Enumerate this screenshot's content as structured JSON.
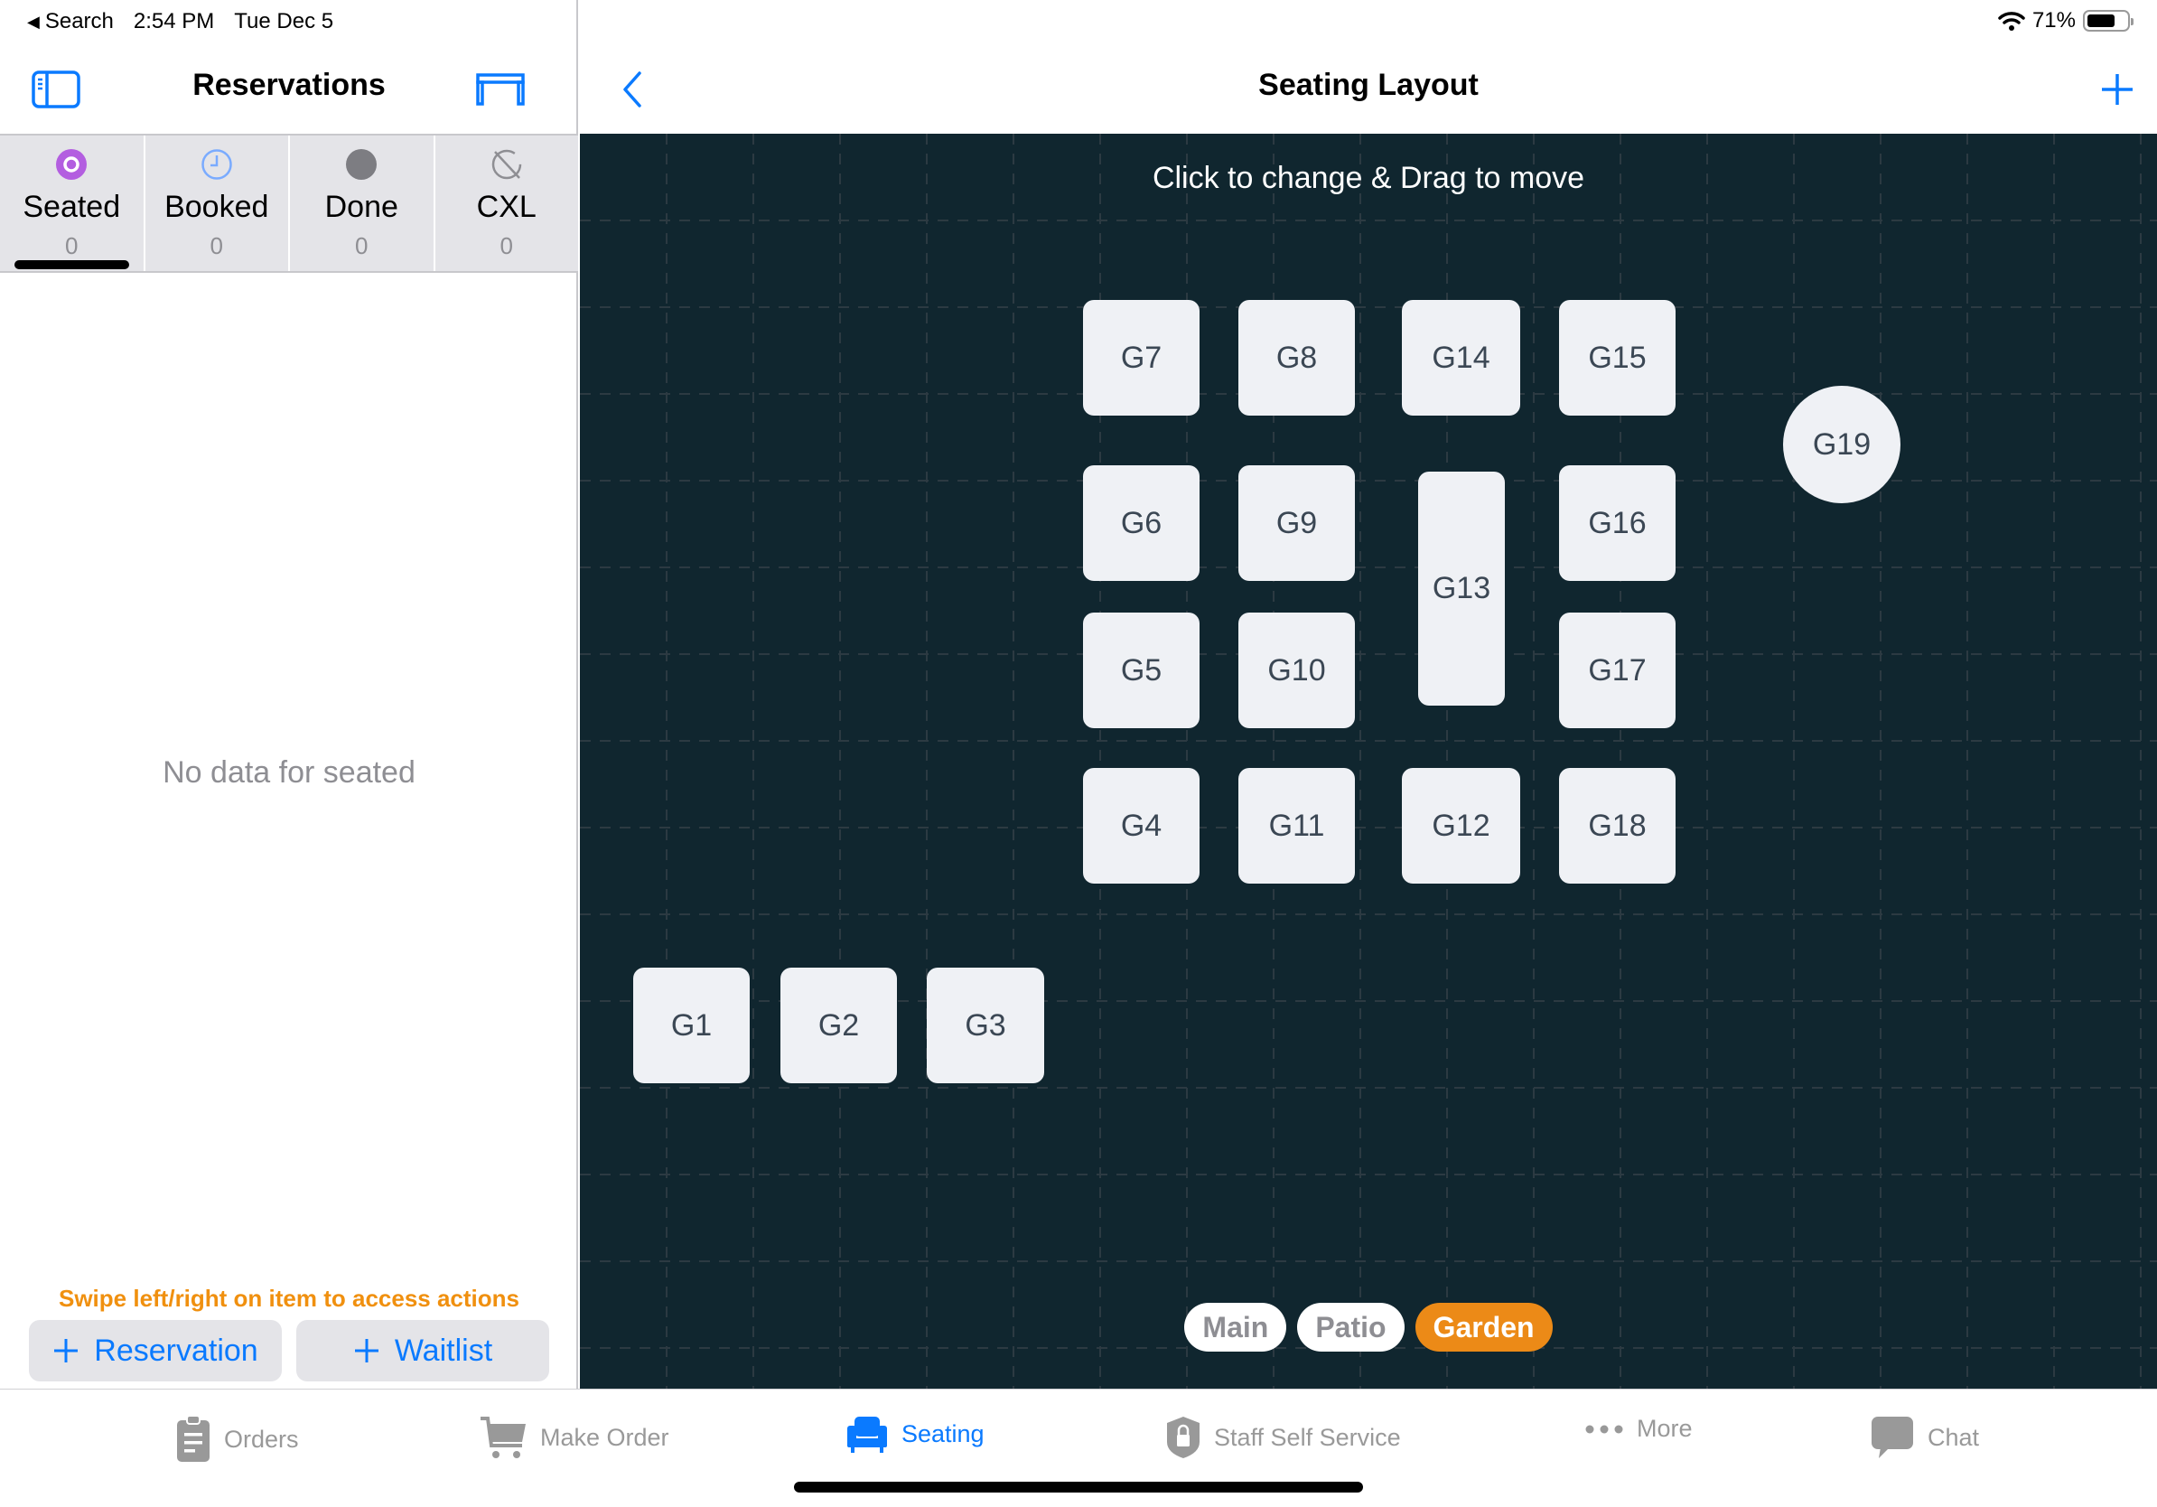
{
  "status_bar": {
    "back_app": "Search",
    "time": "2:54 PM",
    "date": "Tue Dec 5",
    "battery_percent": "71%",
    "battery_level": 0.71
  },
  "sidebar": {
    "title": "Reservations",
    "left_icon": "sidebar-toggle-icon",
    "right_icon": "table-icon",
    "tabs": [
      {
        "label": "Seated",
        "count": "0",
        "icon": "seated-icon",
        "color": "#b35ee0",
        "active": true
      },
      {
        "label": "Booked",
        "count": "0",
        "icon": "clock-icon",
        "color": "#7aabff",
        "active": false
      },
      {
        "label": "Done",
        "count": "0",
        "icon": "filled-circle-icon",
        "color": "#7d7d82",
        "active": false
      },
      {
        "label": "CXL",
        "count": "0",
        "icon": "cancelled-icon",
        "color": "#8e8e93",
        "active": false
      }
    ],
    "empty_message": "No data for seated",
    "hint": "Swipe left/right on item to access actions",
    "buttons": {
      "reservation": "Reservation",
      "waitlist": "Waitlist"
    }
  },
  "main": {
    "title": "Seating Layout",
    "back_icon": "chevron-left-icon",
    "add_icon": "plus-icon",
    "canvas_hint": "Click to change & Drag to move",
    "tables": [
      {
        "label": "G1",
        "shape": "rect"
      },
      {
        "label": "G2",
        "shape": "rect"
      },
      {
        "label": "G3",
        "shape": "rect"
      },
      {
        "label": "G4",
        "shape": "rect"
      },
      {
        "label": "G5",
        "shape": "rect"
      },
      {
        "label": "G6",
        "shape": "rect"
      },
      {
        "label": "G7",
        "shape": "rect"
      },
      {
        "label": "G8",
        "shape": "rect"
      },
      {
        "label": "G9",
        "shape": "rect"
      },
      {
        "label": "G10",
        "shape": "rect"
      },
      {
        "label": "G11",
        "shape": "rect"
      },
      {
        "label": "G12",
        "shape": "rect"
      },
      {
        "label": "G13",
        "shape": "rect"
      },
      {
        "label": "G14",
        "shape": "rect"
      },
      {
        "label": "G15",
        "shape": "rect"
      },
      {
        "label": "G16",
        "shape": "rect"
      },
      {
        "label": "G17",
        "shape": "rect"
      },
      {
        "label": "G18",
        "shape": "rect"
      },
      {
        "label": "G19",
        "shape": "round"
      }
    ],
    "areas": [
      {
        "label": "Main",
        "active": false
      },
      {
        "label": "Patio",
        "active": false
      },
      {
        "label": "Garden",
        "active": true
      }
    ],
    "accent_color": "#ec8a17"
  },
  "tab_bar": {
    "items": [
      {
        "label": "Orders",
        "icon": "clipboard-icon",
        "active": false
      },
      {
        "label": "Make Order",
        "icon": "cart-icon",
        "active": false
      },
      {
        "label": "Seating",
        "icon": "armchair-icon",
        "active": true
      },
      {
        "label": "Staff Self Service",
        "icon": "shield-lock-icon",
        "active": false
      },
      {
        "label": "More",
        "icon": "more-dots-icon",
        "active": false
      },
      {
        "label": "Chat",
        "icon": "chat-bubble-icon",
        "active": false
      }
    ],
    "active_color": "#0a7aff",
    "inactive_color": "#999999"
  }
}
